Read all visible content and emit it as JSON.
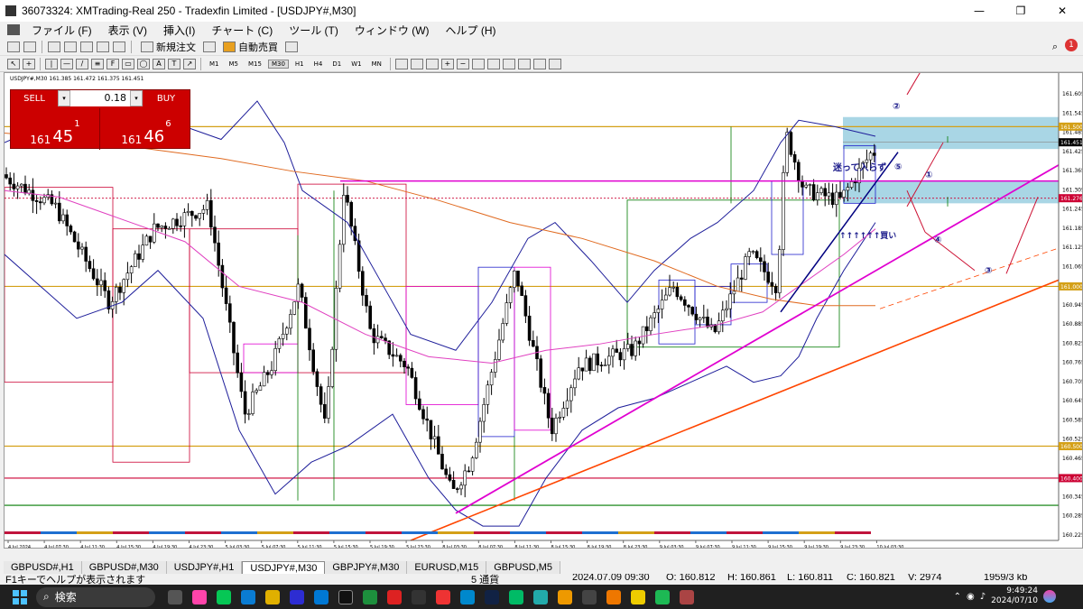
{
  "window": {
    "title": "36073324: XMTrading-Real 250 - Tradexfin Limited - [USDJPY#,M30]",
    "min": "—",
    "restore": "❐",
    "close": "✕"
  },
  "menu": [
    "ファイル (F)",
    "表示 (V)",
    "挿入(I)",
    "チャート (C)",
    "ツール (T)",
    "ウィンドウ (W)",
    "ヘルプ (H)"
  ],
  "toolbar": {
    "new_order": "新規注文",
    "auto_trade": "自動売買"
  },
  "timeframes": [
    "M1",
    "M5",
    "M15",
    "M30",
    "H1",
    "H4",
    "D1",
    "W1",
    "MN"
  ],
  "active_timeframe": "M30",
  "chart": {
    "label": "USDJPY#,M30  161.385 161.472 161.375 161.451",
    "y_ticks": [
      "161.605",
      "161.545",
      "161.485",
      "161.425",
      "161.365",
      "161.305",
      "161.245",
      "161.185",
      "161.125",
      "161.065",
      "161.005",
      "160.945",
      "160.885",
      "160.825",
      "160.765",
      "160.705",
      "160.645",
      "160.585",
      "160.525",
      "160.465",
      "160.405",
      "160.345",
      "160.285",
      "160.225"
    ],
    "tags": [
      {
        "text": "161.500",
        "price": 161.5,
        "color": "#d4a017"
      },
      {
        "text": "161.451",
        "price": 161.451,
        "color": "#000000"
      },
      {
        "text": "161.276",
        "price": 161.276,
        "color": "#cc0033"
      },
      {
        "text": "161.000",
        "price": 161.0,
        "color": "#d4a017"
      },
      {
        "text": "160.500",
        "price": 160.5,
        "color": "#d4a017"
      },
      {
        "text": "160.400",
        "price": 160.4,
        "color": "#cc0033"
      }
    ],
    "x_ticks": [
      "4 Jul 2024",
      "4 Jul 07:30",
      "4 Jul 11:30",
      "4 Jul 15:30",
      "4 Jul 19:30",
      "4 Jul 23:30",
      "5 Jul 03:30",
      "5 Jul 07:30",
      "5 Jul 11:30",
      "5 Jul 15:30",
      "5 Jul 19:30",
      "5 Jul 23:30",
      "8 Jul 03:30",
      "8 Jul 07:30",
      "8 Jul 11:30",
      "8 Jul 15:30",
      "8 Jul 19:30",
      "8 Jul 23:30",
      "9 Jul 03:30",
      "9 Jul 07:30",
      "9 Jul 11:30",
      "9 Jul 15:30",
      "9 Jul 19:30",
      "9 Jul 23:30",
      "10 Jul 03:30"
    ],
    "annotations": {
      "n1": "①",
      "n2": "②",
      "n3": "③",
      "n4": "④",
      "n5": "⑤",
      "hesitate": "迷って入らず",
      "buy": "↑↑↑↑↑↑買い"
    },
    "colors": {
      "upper_band": "#1e1e9a",
      "ma_pink": "#e040c0",
      "ma_orange": "#e06a20",
      "pink_line": "#e000d0",
      "orange_trend": "#ff4500",
      "gold": "#d4a017",
      "crimson": "#cc0033",
      "green": "#007a00",
      "zone": "#8cc8dc"
    }
  },
  "trade_panel": {
    "sell": "SELL",
    "buy": "BUY",
    "lot": "0.18",
    "bid_main": "161",
    "bid_big": "45",
    "bid_sup": "1",
    "ask_main": "161",
    "ask_big": "46",
    "ask_sup": "6"
  },
  "tabs": [
    "GBPUSD#,H1",
    "GBPUSD#,M30",
    "USDJPY#,H1",
    "USDJPY#,M30",
    "GBPJPY#,M30",
    "EURUSD,M15",
    "GBPUSD,M5"
  ],
  "active_tab": "USDJPY#,M30",
  "status": {
    "help": "F1キーでヘルプが表示されます",
    "count": "5 通貨",
    "time": "2024.07.09 09:30",
    "open": "O: 160.812",
    "high": "H: 160.861",
    "low": "L: 160.811",
    "close": "C: 160.821",
    "volume": "V: 2974",
    "net": "1959/3 kb"
  },
  "taskbar": {
    "search": "検索",
    "time": "9:49:24",
    "date": "2024/07/10"
  }
}
